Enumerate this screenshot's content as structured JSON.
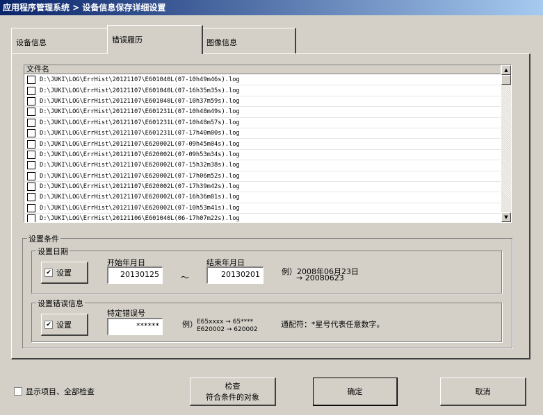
{
  "window": {
    "title": "应用程序管理系统 > 设备信息保存详细设置"
  },
  "tabs": [
    {
      "label": "设备信息"
    },
    {
      "label": "错误履历"
    },
    {
      "label": "图像信息"
    }
  ],
  "file_list": {
    "header": "文件名",
    "rows": [
      "D:\\JUKI\\LOG\\ErrHist\\20121107\\E601040L(07-10h49m46s).log",
      "D:\\JUKI\\LOG\\ErrHist\\20121107\\E601040L(07-16h35m35s).log",
      "D:\\JUKI\\LOG\\ErrHist\\20121107\\E601040L(07-10h37m59s).log",
      "D:\\JUKI\\LOG\\ErrHist\\20121107\\E601231L(07-10h48m49s).log",
      "D:\\JUKI\\LOG\\ErrHist\\20121107\\E601231L(07-10h48m57s).log",
      "D:\\JUKI\\LOG\\ErrHist\\20121107\\E601231L(07-17h40m00s).log",
      "D:\\JUKI\\LOG\\ErrHist\\20121107\\E620002L(07-09h45m04s).log",
      "D:\\JUKI\\LOG\\ErrHist\\20121107\\E620002L(07-09h53m34s).log",
      "D:\\JUKI\\LOG\\ErrHist\\20121107\\E620002L(07-15h32m38s).log",
      "D:\\JUKI\\LOG\\ErrHist\\20121107\\E620002L(07-17h06m52s).log",
      "D:\\JUKI\\LOG\\ErrHist\\20121107\\E620002L(07-17h39m42s).log",
      "D:\\JUKI\\LOG\\ErrHist\\20121107\\E620002L(07-16h36m01s).log",
      "D:\\JUKI\\LOG\\ErrHist\\20121107\\E620002L(07-10h53m41s).log",
      "D:\\JUKI\\LOG\\ErrHist\\20121106\\E601040L(06-17h07m22s).log"
    ]
  },
  "conditions": {
    "group_label": "设置条件",
    "date": {
      "group_label": "设置日期",
      "toggle_label": "设置",
      "start_label": "开始年月日",
      "start_value": "20130125",
      "tilde": "～",
      "end_label": "结束年月日",
      "end_value": "20130201",
      "example_line1": "例）2008年06月23日",
      "example_line2": "→ 20080623"
    },
    "error": {
      "group_label": "设置错误信息",
      "toggle_label": "设置",
      "code_label": "特定错误号",
      "code_value": "******",
      "example_prefix": "例）",
      "example_line1": "E65xxxx → 65****",
      "example_line2": "E620002 → 620002",
      "wildcard_note": "通配符：*星号代表任意数字。"
    }
  },
  "footer": {
    "show_all_label": "显示项目、全部检查",
    "check_line1": "检查",
    "check_line2": "符合条件的对象",
    "ok_label": "确定",
    "cancel_label": "取消"
  },
  "checkmark_glyph": "✔",
  "arrow_up_glyph": "▲",
  "arrow_down_glyph": "▼"
}
